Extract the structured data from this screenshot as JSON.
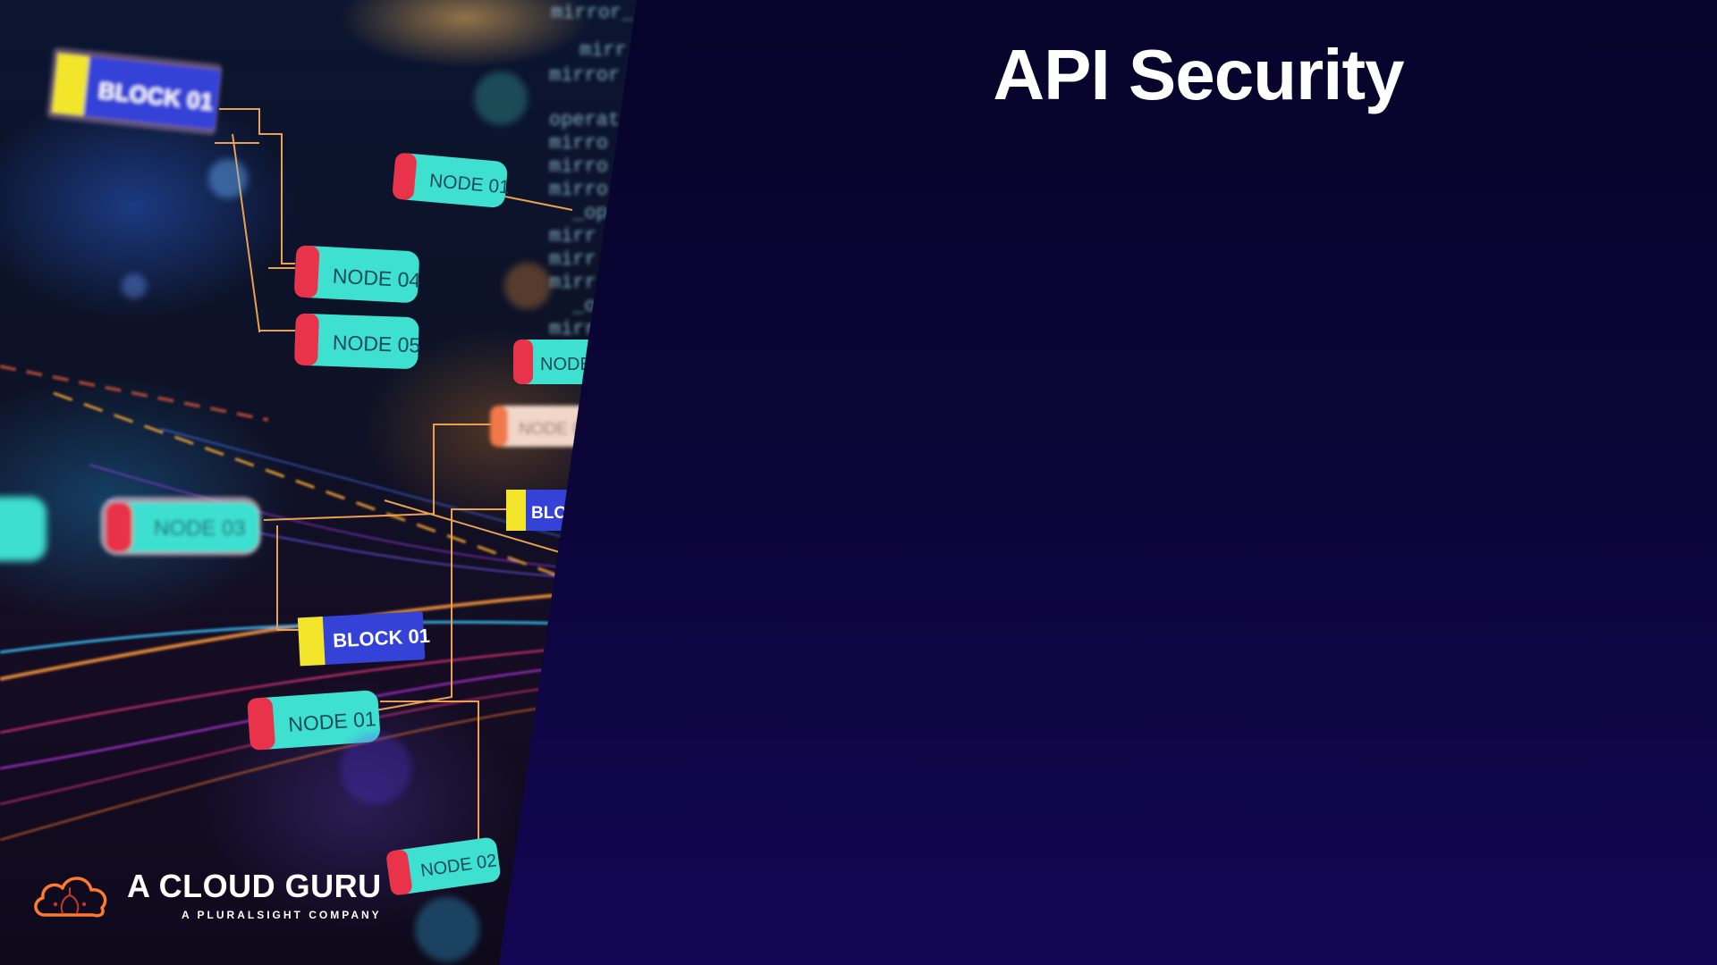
{
  "slide": {
    "title": "API Security"
  },
  "artwork": {
    "labels": {
      "block_01_top": "BLOCK 01",
      "node_01_top": "NODE 01",
      "node_04": "NODE 04",
      "node_05": "NODE 05",
      "node_03": "NODE 03",
      "block_01_mid": "BLOCK 01",
      "node_01_bottom": "NODE 01",
      "node_02": "NODE 02",
      "node_partial_a": "NODE",
      "node_partial_b": "NODE 0",
      "block_partial": "BLOC"
    },
    "code_lines": [
      "mirror_",
      "mirr",
      "mirror",
      "operat",
      "mirro",
      "mirro",
      "mirro",
      "_ope",
      "mirr",
      "mirr",
      "mirr",
      "_op",
      "mirr"
    ]
  },
  "brand": {
    "name": "A CLOUD GURU",
    "tagline": "A PLURALSIGHT COMPANY",
    "accent_color": "#ff7a2f",
    "logo_icon": "cloud-icon"
  },
  "colors": {
    "background_top": "#07032a",
    "background_bottom": "#130654",
    "node_fill": "#3ee0d0",
    "node_tab": "#e8334a",
    "block_fill": "#2f3fd8",
    "block_tab": "#f2e52a"
  }
}
